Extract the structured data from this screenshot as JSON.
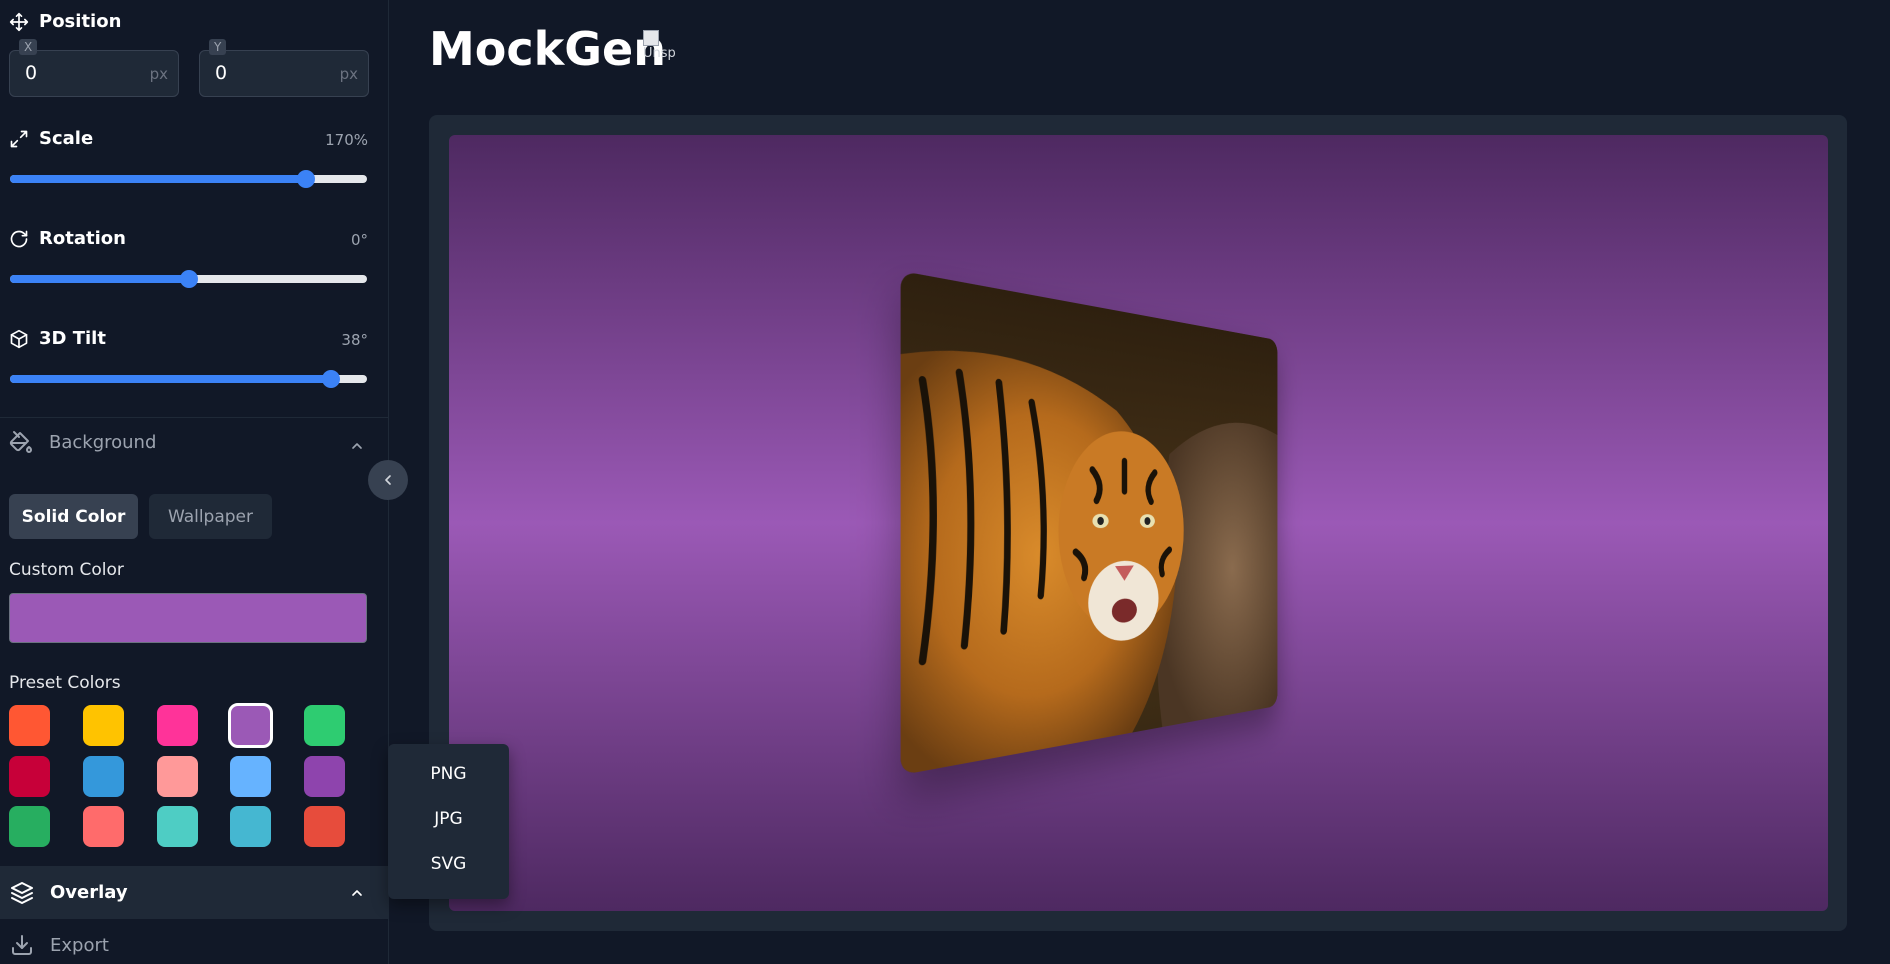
{
  "app": {
    "title": "MockGen",
    "logo_alt": "Unsp"
  },
  "position": {
    "label": "Position",
    "x": {
      "tag": "X",
      "value": "0",
      "unit": "px"
    },
    "y": {
      "tag": "Y",
      "value": "0",
      "unit": "px"
    }
  },
  "scale": {
    "label": "Scale",
    "display": "170%",
    "level": 0.83
  },
  "rotation": {
    "label": "Rotation",
    "display": "0°",
    "level": 0.5
  },
  "tilt": {
    "label": "3D Tilt",
    "display": "38°",
    "level": 0.9
  },
  "background": {
    "label": "Background",
    "tabs": {
      "active": "Solid Color",
      "inactive": "Wallpaper"
    },
    "custom_label": "Custom Color",
    "custom_color": "#9b59b6",
    "preset_label": "Preset Colors",
    "presets": [
      "#ff5733",
      "#ffc300",
      "#ff3399",
      "#9b59b6",
      "#2ecc71",
      "#c70039",
      "#3498db",
      "#ff9999",
      "#66b3ff",
      "#8e44ad",
      "#27ae60",
      "#ff6b6b",
      "#4ecdc4",
      "#45b7d1",
      "#e74c3c"
    ],
    "selected_preset": "#9b59b6"
  },
  "overlay": {
    "label": "Overlay"
  },
  "export": {
    "label": "Export",
    "formats": [
      "PNG",
      "JPG",
      "SVG"
    ]
  },
  "colors": {
    "accent": "#3b82f6"
  }
}
